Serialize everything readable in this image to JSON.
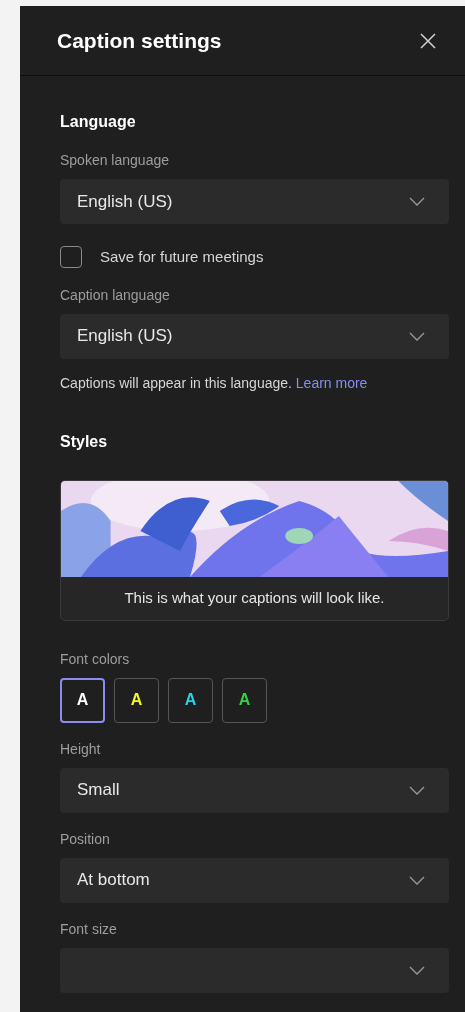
{
  "panel": {
    "title": "Caption settings"
  },
  "sections": [
    {
      "heading": "Language",
      "fields": [
        {
          "kind": "dropdown",
          "label": "Spoken language",
          "value": "English (US)"
        },
        {
          "kind": "checkbox",
          "label": "Save for future meetings",
          "checked": false
        },
        {
          "kind": "dropdown",
          "label": "Caption language",
          "value": "English (US)",
          "help": "Captions will appear in this language.",
          "link": "Learn more"
        }
      ]
    },
    {
      "heading": "Styles",
      "fields": [
        {
          "kind": "preview",
          "caption": "This is what your captions will look like."
        },
        {
          "kind": "swatches",
          "label": "Font colors",
          "options": [
            {
              "letter": "A",
              "color": "#ffffff",
              "selected": true
            },
            {
              "letter": "A",
              "color": "#f5f523",
              "selected": false
            },
            {
              "letter": "A",
              "color": "#2ad3e8",
              "selected": false
            },
            {
              "letter": "A",
              "color": "#35d13e",
              "selected": false
            }
          ]
        },
        {
          "kind": "dropdown",
          "label": "Height",
          "value": "Small"
        },
        {
          "kind": "dropdown",
          "label": "Position",
          "value": "At bottom"
        },
        {
          "kind": "dropdown",
          "label": "Font size"
        }
      ]
    }
  ]
}
